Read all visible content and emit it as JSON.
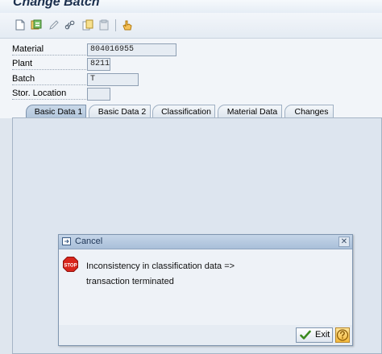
{
  "window": {
    "title": "Change Batch"
  },
  "toolbar": {
    "icons": [
      "new-document-icon",
      "other-object-icon",
      "edit-pencil-icon",
      "link-icon",
      "copy-icon",
      "paste-icon",
      "hand-pointer-icon"
    ]
  },
  "form": {
    "material_label": "Material",
    "material_value": "804016955",
    "plant_label": "Plant",
    "plant_value": "8211",
    "batch_label": "Batch",
    "batch_value": "T",
    "storage_label": "Stor. Location",
    "storage_value": ""
  },
  "tabs": [
    {
      "label": "Basic Data 1",
      "active": true
    },
    {
      "label": "Basic Data 2",
      "active": false
    },
    {
      "label": "Classification",
      "active": false
    },
    {
      "label": "Material Data",
      "active": false
    },
    {
      "label": "Changes",
      "active": false
    }
  ],
  "dialog": {
    "title": "Cancel",
    "stop_text": "STOP",
    "message_line1": "Inconsistency in classification data =>",
    "message_line2": "transaction terminated",
    "exit_label": "Exit",
    "close_symbol": "✕"
  },
  "colors": {
    "title_text": "#1b2f4d",
    "active_tab": "#b2c6dc",
    "stop_red": "#d9261c",
    "exit_check": "#3a8a1e",
    "help_orange": "#f3b83c"
  }
}
